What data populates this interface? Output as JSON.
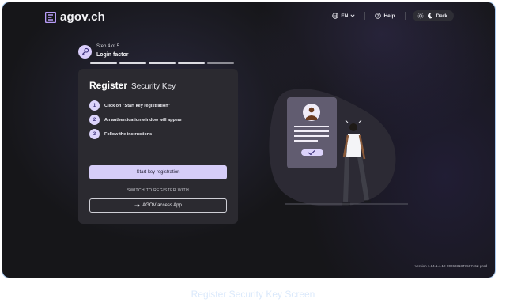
{
  "header": {
    "logo_text": "agov.ch",
    "lang_label": "EN",
    "help_label": "Help",
    "theme_label": "Dark"
  },
  "stepper": {
    "step_text": "Step 4 of 5",
    "step_title": "Login factor",
    "total_steps": 5,
    "completed_steps": 4
  },
  "card": {
    "title": "Register",
    "subtitle": "Security Key",
    "instructions": [
      {
        "num": "1",
        "text": "Click on \"Start key registration\""
      },
      {
        "num": "2",
        "text": "An authentication window will appear"
      },
      {
        "num": "3",
        "text": "Follow the instructions"
      }
    ],
    "primary_button": "Start key registration",
    "divider_label": "SWITCH TO REGISTER WITH",
    "secondary_button": "AGOV access App"
  },
  "footer": {
    "version": "Version 1.14.1.4.12-20260318T150746Z-prod"
  },
  "caption": "Register Security Key Screen",
  "colors": {
    "accent": "#d6cdf8",
    "background": "#161619",
    "card": "#2b2a30",
    "frame_border": "#a9c9ef"
  }
}
